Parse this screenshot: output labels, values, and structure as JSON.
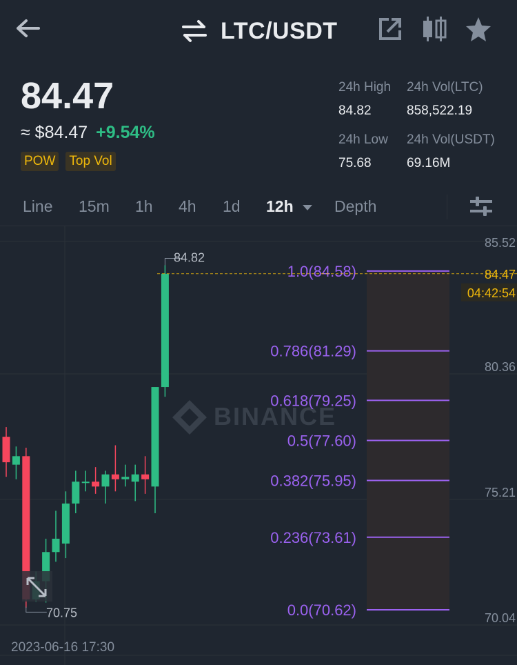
{
  "header": {
    "back_icon": "arrow-left-icon",
    "swap_icon": "swap-arrows-icon",
    "pair": "LTC/USDT",
    "share_icon": "external-share-icon",
    "compare_icon": "candle-compare-icon",
    "favorite_icon": "star-icon"
  },
  "price": {
    "last": "84.47",
    "usd": "≈ $84.47",
    "change": "+9.54%"
  },
  "tags": [
    "POW",
    "Top Vol"
  ],
  "stats": {
    "high_label": "24h High",
    "high_value": "84.82",
    "vol_ltc_label": "24h Vol(LTC)",
    "vol_ltc_value": "858,522.19",
    "low_label": "24h Low",
    "low_value": "75.68",
    "vol_usdt_label": "24h Vol(USDT)",
    "vol_usdt_value": "69.16M"
  },
  "tabs": {
    "line": "Line",
    "m15": "15m",
    "h1": "1h",
    "h4": "4h",
    "d1": "1d",
    "h12": "12h",
    "depth": "Depth",
    "settings_icon": "sliders-icon"
  },
  "chart_data": {
    "type": "candlestick",
    "y_axis_labels": [
      "85.52",
      "80.36",
      "75.21",
      "70.04"
    ],
    "ylim": [
      69.5,
      86.5
    ],
    "current_price": "84.47",
    "countdown": "04:42:54",
    "high_marker": "84.82",
    "low_marker": "70.75",
    "watermark": "BINANCE",
    "x_label": "2023-06-16 17:30",
    "colors": {
      "up": "#2ebd85",
      "down": "#f6465d",
      "fib": "#9b62f0",
      "price_line": "#f0b90b"
    },
    "candles": [
      {
        "o": 77.75,
        "h": 78.15,
        "l": 76.1,
        "c": 76.7
      },
      {
        "o": 76.6,
        "h": 77.35,
        "l": 76.0,
        "c": 76.95
      },
      {
        "o": 76.95,
        "h": 77.3,
        "l": 70.7,
        "c": 71.05
      },
      {
        "o": 71.05,
        "h": 72.2,
        "l": 70.95,
        "c": 71.8
      },
      {
        "o": 71.8,
        "h": 73.55,
        "l": 70.92,
        "c": 73.0
      },
      {
        "o": 73.0,
        "h": 74.7,
        "l": 72.6,
        "c": 73.55
      },
      {
        "o": 73.35,
        "h": 75.5,
        "l": 72.75,
        "c": 75.0
      },
      {
        "o": 75.0,
        "h": 76.35,
        "l": 74.6,
        "c": 75.9
      },
      {
        "o": 75.9,
        "h": 76.35,
        "l": 75.5,
        "c": 75.9
      },
      {
        "o": 75.9,
        "h": 76.5,
        "l": 75.4,
        "c": 75.7
      },
      {
        "o": 75.7,
        "h": 76.35,
        "l": 75.0,
        "c": 76.2
      },
      {
        "o": 76.2,
        "h": 77.4,
        "l": 75.5,
        "c": 76.0
      },
      {
        "o": 76.0,
        "h": 76.6,
        "l": 75.7,
        "c": 76.1
      },
      {
        "o": 75.9,
        "h": 76.6,
        "l": 75.1,
        "c": 76.2
      },
      {
        "o": 76.2,
        "h": 76.95,
        "l": 75.4,
        "c": 76.0
      },
      {
        "o": 75.7,
        "h": 78.9,
        "l": 74.6,
        "c": 79.8
      },
      {
        "o": 79.8,
        "h": 84.82,
        "l": 79.4,
        "c": 84.47
      }
    ],
    "fib_levels": [
      {
        "label": "1.0(84.58)",
        "value": 84.58
      },
      {
        "label": "0.786(81.29)",
        "value": 81.29
      },
      {
        "label": "0.618(79.25)",
        "value": 79.25
      },
      {
        "label": "0.5(77.60)",
        "value": 77.6
      },
      {
        "label": "0.382(75.95)",
        "value": 75.95
      },
      {
        "label": "0.236(73.61)",
        "value": 73.61
      },
      {
        "label": "0.0(70.62)",
        "value": 70.62
      }
    ]
  }
}
